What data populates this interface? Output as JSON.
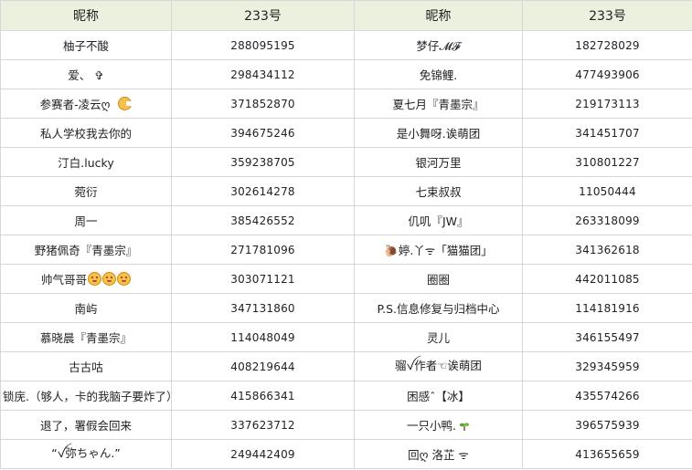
{
  "table": {
    "headers": [
      "昵称",
      "233号",
      "昵称",
      "233号"
    ],
    "rows": [
      {
        "left_name": "柚子不酸",
        "left_id": "288095195",
        "right_name": "梦仔𝓜𝓕",
        "right_id": "182728029"
      },
      {
        "left_name": "爱、 ✞",
        "left_id": "298434112",
        "right_name": "免锦鲤.",
        "right_id": "477493906"
      },
      {
        "left_name": "参赛者-凌云ღ",
        "left_id": "371852870",
        "right_name": "夏七月『青墨宗』",
        "right_id": "219173113"
      },
      {
        "left_name": "私人学校我去你的",
        "left_id": "394675246",
        "right_name": "是小舞呀.诶萌团",
        "right_id": "341451707"
      },
      {
        "left_name": "汀白.lucky",
        "left_id": "359238705",
        "right_name": "银河万里",
        "right_id": "310801227"
      },
      {
        "left_name": "菀衍",
        "left_id": "302614278",
        "right_name": "七束叔叔",
        "right_id": "11050444"
      },
      {
        "left_name": "周一",
        "left_id": "385426552",
        "right_name": "仉叽『JW』",
        "right_id": "263318099"
      },
      {
        "left_name": "野猪佩奇『青墨宗』",
        "left_id": "271781096",
        "right_name": "🐌婷.丫ᯤ「猫猫团」",
        "right_id": "341362618"
      },
      {
        "left_name": "帅气哥哥",
        "left_id": "303071121",
        "right_name": "圈圈",
        "right_id": "442011085"
      },
      {
        "left_name": "南屿",
        "left_id": "347131860",
        "right_name": "P.S.信息修复与归档中心",
        "right_id": "114181916"
      },
      {
        "left_name": "慕晓晨『青墨宗』",
        "left_id": "114048049",
        "right_name": "灵儿",
        "right_id": "346155497"
      },
      {
        "left_name": "古古咕",
        "left_id": "408219644",
        "right_name": "骝ꪜ作者☜诶萌团",
        "right_id": "329345959"
      },
      {
        "left_name": "锁庑.（够人，卡的我脑子要炸了）",
        "left_id": "415866341",
        "right_name": "困感ˆ【冰】",
        "right_id": "435574266"
      },
      {
        "left_name": "退了，署假会回来",
        "left_id": "337623712",
        "right_name": "一只小鸭.",
        "right_id": "396575939"
      },
      {
        "left_name": "“ꪜ弥ちゃん.”",
        "left_id": "249442409",
        "right_name": "回ღ 洛芷 ᯤ",
        "right_id": "413655659"
      }
    ]
  },
  "icons": {
    "row3_left": "pacman-emoji-icon",
    "row9_left": "smiley-emoji-icon",
    "row14_right": "sprout-icon"
  },
  "colors": {
    "header_bg": "#ebf1de",
    "grid": "#d8d8d8",
    "emoji_yellow": "#f6c04a"
  }
}
